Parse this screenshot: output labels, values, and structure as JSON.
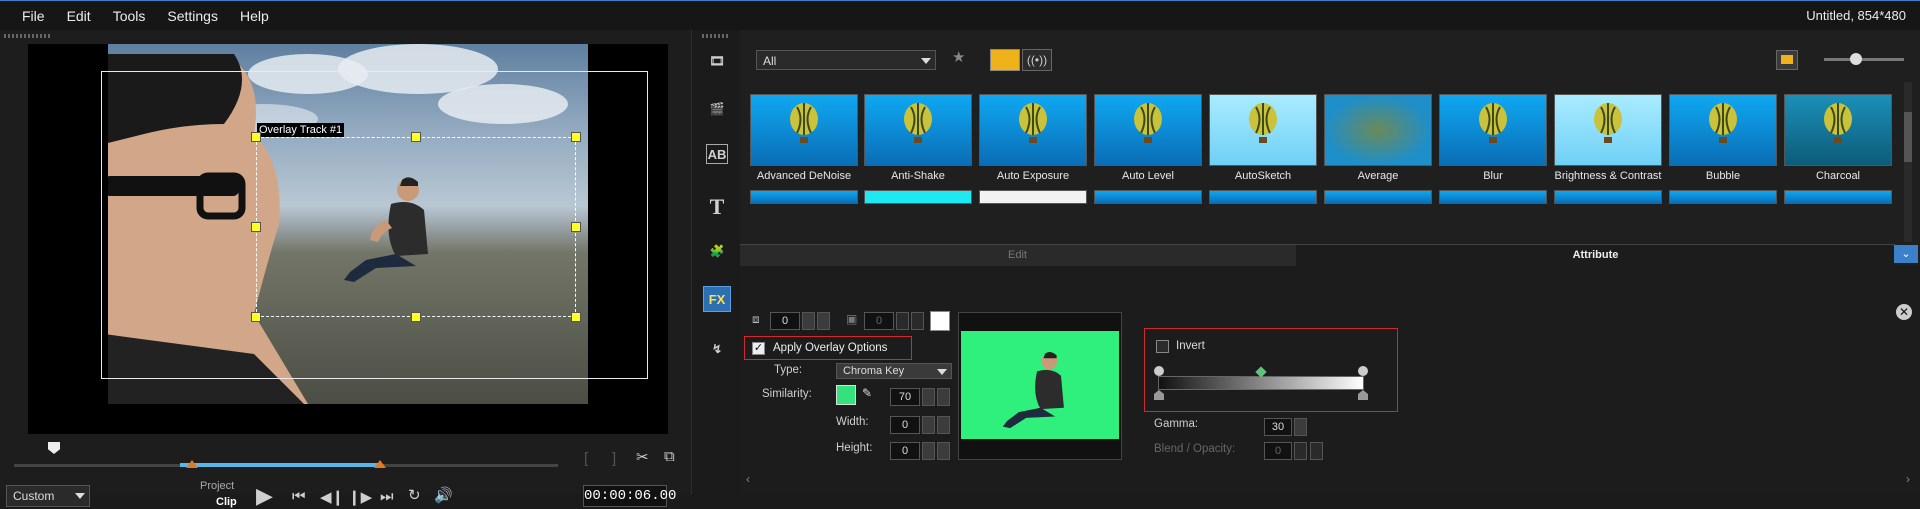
{
  "menu": {
    "items": [
      "File",
      "Edit",
      "Tools",
      "Settings",
      "Help"
    ],
    "project_title": "Untitled, 854*480"
  },
  "preview": {
    "overlay_label": "Overlay Track #1"
  },
  "playback": {
    "mode_select": "Custom",
    "project_label": "Project",
    "clip_label": "Clip",
    "timecode": "00:00:06.00"
  },
  "library": {
    "filter_select": "All",
    "thumbs": [
      "Advanced DeNoise",
      "Anti-Shake",
      "Auto Exposure",
      "Auto Level",
      "AutoSketch",
      "Average",
      "Blur",
      "Brightness & Contrast",
      "Bubble",
      "Charcoal"
    ]
  },
  "tabs": {
    "edit": "Edit",
    "attribute": "Attribute"
  },
  "attribute": {
    "border_value": "0",
    "shadow_value": "0",
    "apply_overlay": "Apply Overlay Options",
    "apply_overlay_checked": true,
    "type_label": "Type:",
    "type_value": "Chroma Key",
    "similarity_label": "Similarity:",
    "similarity_value": "70",
    "key_color": "#33e27a",
    "width_label": "Width:",
    "width_value": "0",
    "height_label": "Height:",
    "height_value": "0",
    "invert_label": "Invert",
    "gamma_label": "Gamma:",
    "gamma_value": "30",
    "blend_label": "Blend / Opacity:",
    "blend_value": "0"
  },
  "colors": {
    "accent": "#3b80c8",
    "highlight_box": "#d02a2a",
    "handle": "#ffff28"
  }
}
